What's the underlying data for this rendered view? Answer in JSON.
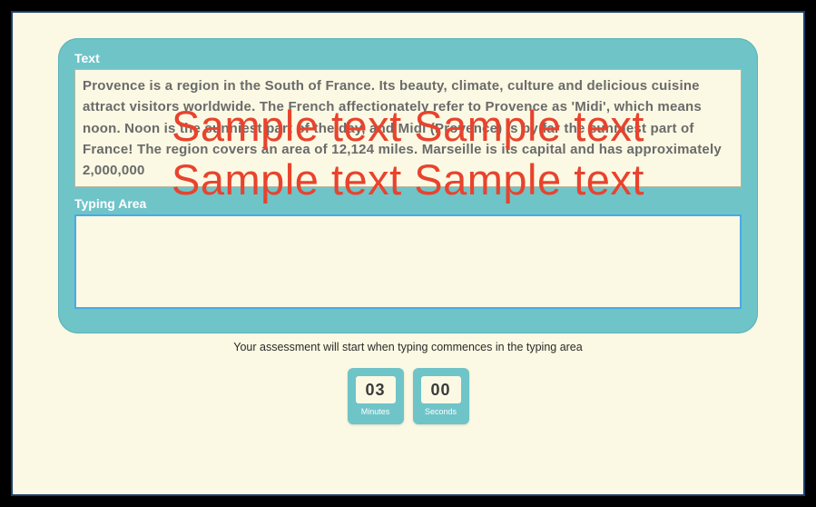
{
  "panel": {
    "text_label": "Text",
    "typing_label": "Typing Area",
    "sample_text": "Provence is a region in the South of France. Its beauty, climate, culture and delicious cuisine attract visitors worldwide. The French affectionately refer to Provence as 'Midi', which means noon. Noon is the sunniest part of the day, and Midi (Provence) is by far the sunniest part of France! The region covers an area of 12,124 miles. Marseille is its capital and has approximately 2,000,000",
    "typing_value": ""
  },
  "instruction": "Your assessment will start when typing commences in the typing area",
  "timer": {
    "minutes_value": "03",
    "minutes_label": "Minutes",
    "seconds_value": "00",
    "seconds_label": "Seconds"
  },
  "watermark": {
    "line1": "Sample text  Sample text",
    "line2": "Sample text  Sample text"
  }
}
